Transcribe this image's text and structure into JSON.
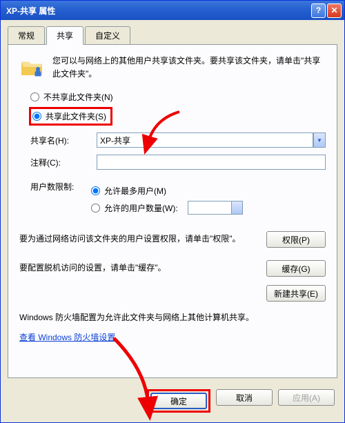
{
  "title": "XP-共享 属性",
  "tabs": {
    "t0": "常规",
    "t1": "共享",
    "t2": "自定义"
  },
  "intro": "您可以与网络上的其他用户共享该文件夹。要共享该文件夹，请单击\"共享此文件夹\"。",
  "radio": {
    "no": "不共享此文件夹(N)",
    "yes": "共享此文件夹(S)"
  },
  "shareName": {
    "label": "共享名(H):",
    "value": "XP-共享"
  },
  "comment": {
    "label": "注释(C):"
  },
  "limit": {
    "label": "用户数限制:",
    "max": "允许最多用户(M)",
    "custom": "允许的用户数量(W):"
  },
  "perm": {
    "text": "要为通过网络访问该文件夹的用户设置权限，请单击\"权限\"。",
    "btn": "权限(P)"
  },
  "cache": {
    "text": "要配置脱机访问的设置，请单击\"缓存\"。",
    "btn": "缓存(G)"
  },
  "newShare": "新建共享(E)",
  "firewall": {
    "text": "Windows 防火墙配置为允许此文件夹与网络上其他计算机共享。",
    "link": "查看 Windows 防火墙设置"
  },
  "buttons": {
    "ok": "确定",
    "cancel": "取消",
    "apply": "应用(A)"
  }
}
